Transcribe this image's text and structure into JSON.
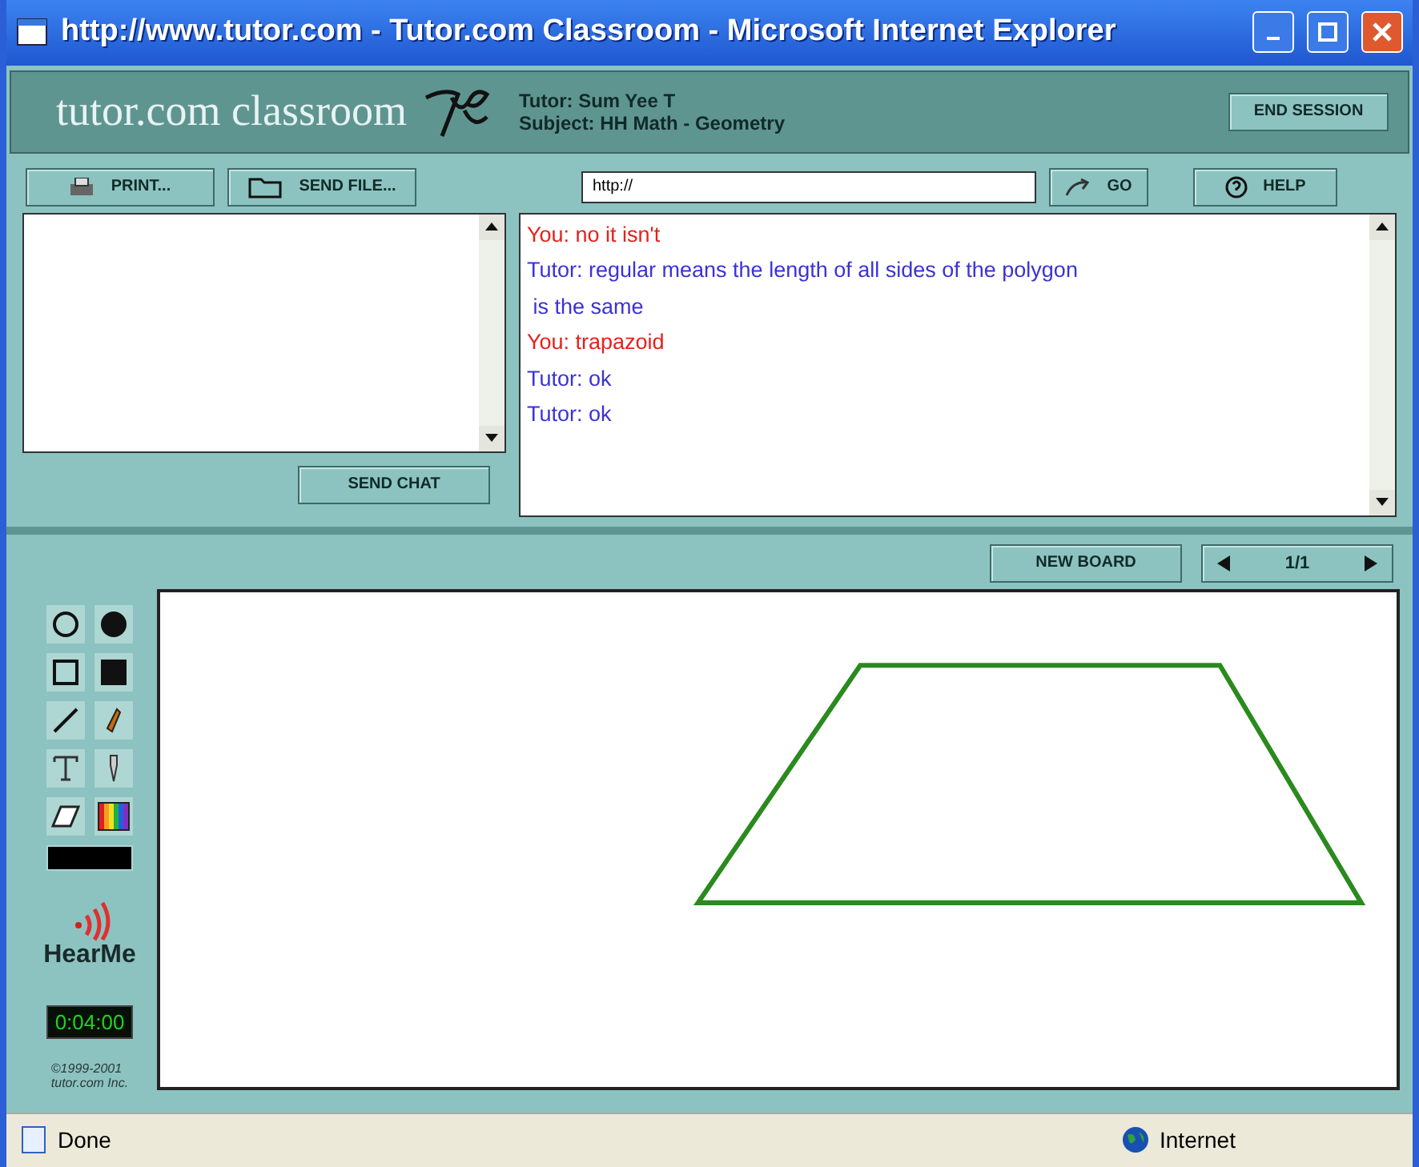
{
  "window": {
    "title": "http://www.tutor.com - Tutor.com Classroom - Microsoft Internet Explorer"
  },
  "header": {
    "logo": "tutor.com classroom",
    "tutor": "Tutor: Sum Yee T",
    "subject": "Subject: HH Math - Geometry",
    "end_button": "END SESSION"
  },
  "toolbar": {
    "print": "PRINT...",
    "send_file": "SEND FILE...",
    "url": "http://",
    "go": "GO",
    "help": "HELP"
  },
  "chat": {
    "send_button": "SEND CHAT",
    "messages": [
      {
        "kind": "you",
        "lines": [
          "You: no it isn't"
        ]
      },
      {
        "kind": "tutor",
        "lines": [
          "Tutor: regular means the length of all sides of the polygon",
          " is the same"
        ]
      },
      {
        "kind": "you",
        "lines": [
          "You: trapazoid"
        ]
      },
      {
        "kind": "tutor",
        "lines": [
          "Tutor: ok"
        ]
      },
      {
        "kind": "tutor",
        "lines": [
          "Tutor: ok"
        ]
      }
    ]
  },
  "board": {
    "new_board": "NEW BOARD",
    "page": "1/1"
  },
  "sidebar": {
    "hearme": "HearMe",
    "timer": "0:04:00",
    "copyright": [
      "©1999-2001",
      "tutor.com Inc."
    ]
  },
  "status_bar": {
    "status": "Done",
    "zone": "Internet"
  }
}
